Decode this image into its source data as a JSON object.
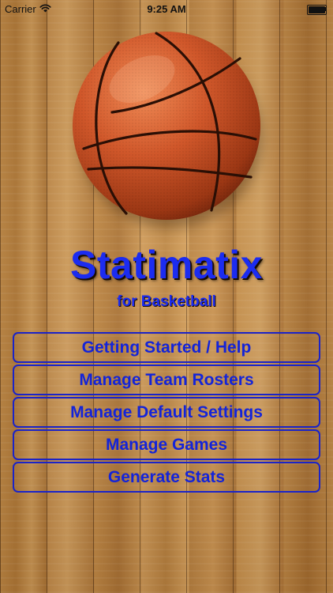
{
  "status_bar": {
    "carrier": "Carrier",
    "time": "9:25 AM",
    "wifi_icon": "wifi-icon",
    "battery_icon": "battery-icon",
    "battery_level": 1.0
  },
  "hero": {
    "image": "basketball-image"
  },
  "title": "Statimatix",
  "subtitle": "for Basketball",
  "menu": [
    {
      "label": "Getting Started / Help"
    },
    {
      "label": "Manage Team Rosters"
    },
    {
      "label": "Manage Default Settings"
    },
    {
      "label": "Manage Games"
    },
    {
      "label": "Generate Stats"
    }
  ],
  "colors": {
    "accent": "#1c2cf0",
    "button_border": "#1a23c8",
    "background": "#b27a3a"
  }
}
